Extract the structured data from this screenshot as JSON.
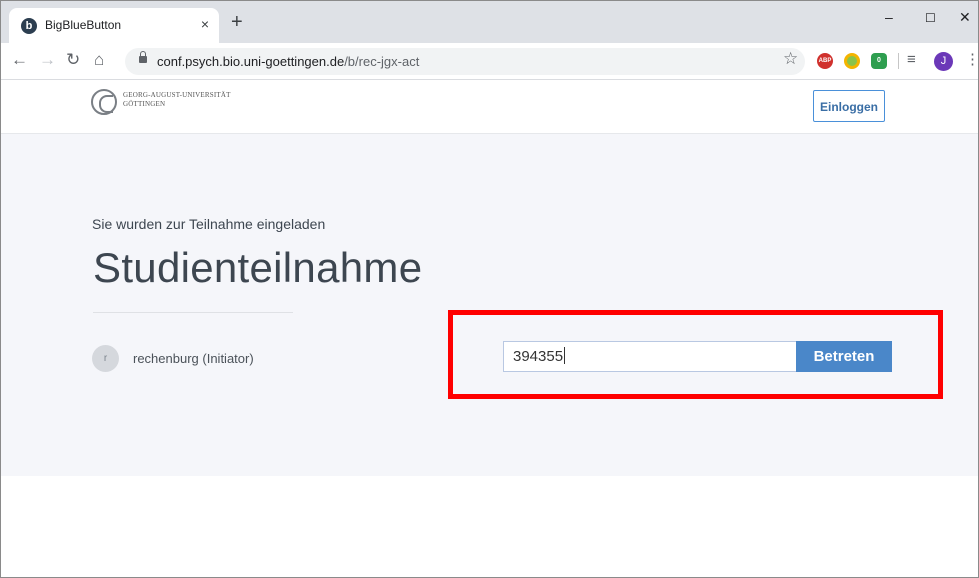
{
  "browser": {
    "tab_title": "BigBlueButton",
    "tab_favicon_letter": "b",
    "tab_close": "×",
    "new_tab": "+",
    "minimize": "–",
    "maximize": "☐",
    "close": "✕",
    "url_host": "conf.psych.bio.uni-goettingen.de",
    "url_path": "/b/rec-jgx-act",
    "profile_initial": "J",
    "ext_abp": "ABP",
    "ext_badge": "0"
  },
  "header": {
    "logo_line1": "GEORG-AUGUST-UNIVERSITÄT",
    "logo_line2": "GÖTTINGEN",
    "login_label": "Einloggen"
  },
  "room": {
    "invite_text": "Sie wurden zur Teilnahme eingeladen",
    "title": "Studienteilnahme",
    "owner_initial": "r",
    "owner_name": "rechenburg (Initiator)",
    "code_value": "394355",
    "join_label": "Betreten"
  },
  "colors": {
    "accent": "#4a87c9",
    "highlight": "#ff0000"
  }
}
